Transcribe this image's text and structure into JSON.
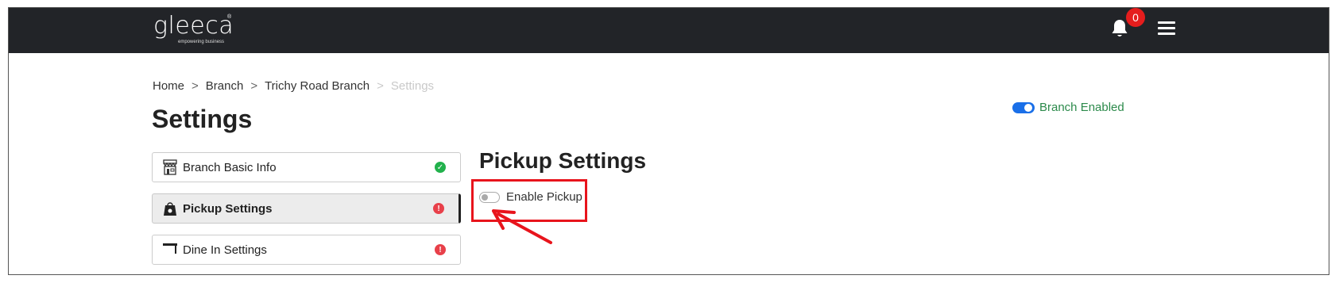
{
  "header": {
    "logo_text": "gleeca",
    "logo_registered": "®",
    "logo_tagline": "empowering business",
    "notification_count": "0",
    "bell_icon": "bell-icon",
    "menu_icon": "hamburger-menu-icon"
  },
  "breadcrumb": {
    "items": [
      "Home",
      "Branch",
      "Trichy Road Branch"
    ],
    "current": "Settings",
    "separator": ">"
  },
  "page_title": "Settings",
  "branch_toggle": {
    "label": "Branch Enabled",
    "enabled": true
  },
  "sidebar": {
    "items": [
      {
        "label": "Branch Basic Info",
        "icon": "storefront-icon",
        "status": "complete",
        "status_icon": "check-circle-icon"
      },
      {
        "label": "Pickup Settings",
        "icon": "shopping-bag-icon",
        "status": "incomplete",
        "status_icon": "exclamation-circle-icon",
        "active": true
      },
      {
        "label": "Dine In Settings",
        "icon": "table-icon",
        "status": "incomplete",
        "status_icon": "exclamation-circle-icon"
      }
    ]
  },
  "main": {
    "section_title": "Pickup Settings",
    "enable_pickup": {
      "label": "Enable Pickup",
      "enabled": false
    }
  },
  "annotation": {
    "color": "#e8141c"
  },
  "colors": {
    "header_bg": "#222428",
    "accent_blue": "#1a6fe8",
    "success_green": "#22b14c",
    "error_red": "#e8404a",
    "enabled_text": "#2c8a4b"
  }
}
